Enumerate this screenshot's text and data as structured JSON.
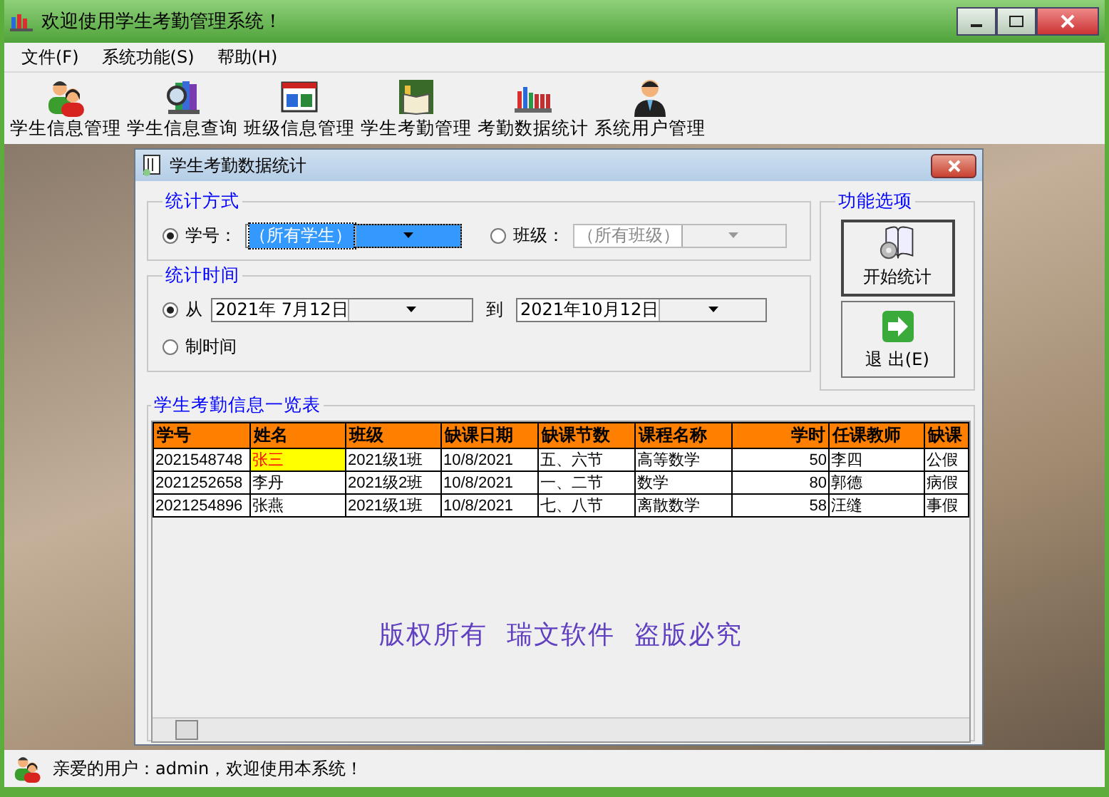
{
  "window": {
    "title": "欢迎使用学生考勤管理系统！"
  },
  "menu": [
    {
      "label": "文件(F)"
    },
    {
      "label": "系统功能(S)"
    },
    {
      "label": "帮助(H)"
    }
  ],
  "toolbar": [
    {
      "label": "学生信息管理",
      "kind": "people"
    },
    {
      "label": "学生信息查询",
      "kind": "search"
    },
    {
      "label": "班级信息管理",
      "kind": "board"
    },
    {
      "label": "学生考勤管理",
      "kind": "book"
    },
    {
      "label": "考勤数据统计",
      "kind": "shelf"
    },
    {
      "label": "系统用户管理",
      "kind": "user"
    }
  ],
  "dialog": {
    "title": "学生考勤数据统计",
    "mode_group": {
      "title": "统计方式",
      "options": [
        {
          "label": "学号：",
          "selected": true,
          "value": "（所有学生）",
          "disabled": false
        },
        {
          "label": "班级：",
          "selected": false,
          "value": "（所有班级）",
          "disabled": true
        }
      ]
    },
    "time_group": {
      "title": "统计时间",
      "options": [
        {
          "label": "从",
          "selected": true
        },
        {
          "label": "制时间",
          "selected": false
        }
      ],
      "from": "2021年 7月12日",
      "to_label": "到",
      "to": "2021年10月12日"
    },
    "function_group": {
      "title": "功能选项",
      "buttons": [
        {
          "label": "开始统计",
          "kind": "start"
        },
        {
          "label": "退 出(E)",
          "kind": "exit"
        }
      ]
    },
    "list_group": {
      "title": "学生考勤信息一览表",
      "columns": [
        {
          "label": "学号",
          "kind": "text"
        },
        {
          "label": "姓名",
          "kind": "text"
        },
        {
          "label": "班级",
          "kind": "text"
        },
        {
          "label": "缺课日期",
          "kind": "text"
        },
        {
          "label": "缺课节数",
          "kind": "text"
        },
        {
          "label": "课程名称",
          "kind": "text"
        },
        {
          "label": "学时",
          "kind": "number"
        },
        {
          "label": "任课教师",
          "kind": "text"
        },
        {
          "label": "缺课",
          "kind": "text"
        }
      ],
      "rows": [
        {
          "selected": true,
          "cells": [
            "2021548748",
            "张三",
            "2021级1班",
            "10/8/2021",
            "五、六节",
            "高等数学",
            "50",
            "李四",
            "公假"
          ]
        },
        {
          "selected": false,
          "cells": [
            "2021252658",
            "李丹",
            "2021级2班",
            "10/8/2021",
            "一、二节",
            "数学",
            "80",
            "郭德",
            "病假"
          ]
        },
        {
          "selected": false,
          "cells": [
            "2021254896",
            "张燕",
            "2021级1班",
            "10/8/2021",
            "七、八节",
            "离散数学",
            "58",
            "汪缝",
            "事假"
          ]
        }
      ],
      "notice": "版权所有  瑞文软件  盗版必究"
    }
  },
  "status_bar": {
    "text": "亲爱的用户：admin，欢迎使用本系统！"
  }
}
